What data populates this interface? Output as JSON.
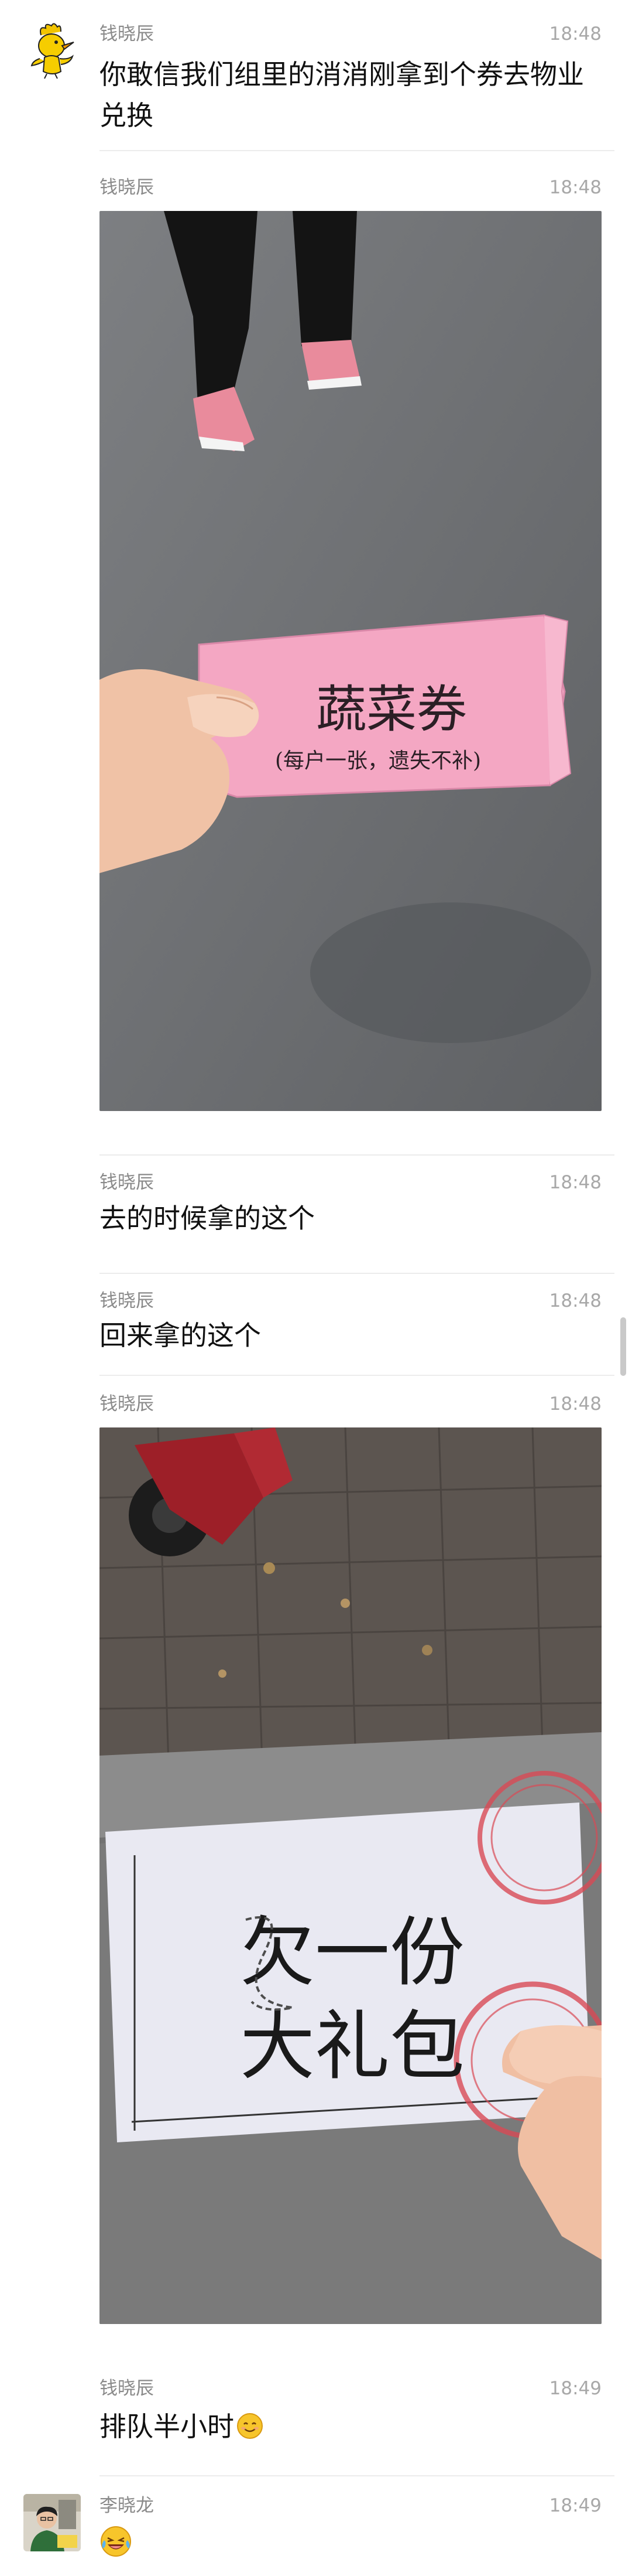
{
  "messages": [
    {
      "name": "钱晓辰",
      "time": "18:48",
      "text": "你敢信我们组里的消消刚拿到个券去物业兑换"
    },
    {
      "name": "钱晓辰",
      "time": "18:48"
    },
    {
      "name": "钱晓辰",
      "time": "18:48",
      "text": "去的时候拿的这个"
    },
    {
      "name": "钱晓辰",
      "time": "18:48",
      "text": "回来拿的这个"
    },
    {
      "name": "钱晓辰",
      "time": "18:48"
    },
    {
      "name": "钱晓辰",
      "time": "18:49",
      "text": "排队半小时"
    },
    {
      "name": "李晓龙",
      "time": "18:49"
    }
  ],
  "photo1": {
    "ticket_title": "蔬菜券",
    "ticket_note": "(每户一张，遗失不补)"
  },
  "photo2": {
    "ticket_line1": "欠一份",
    "ticket_line2": "大礼包"
  },
  "colors": {
    "name": "#8a8a8a",
    "time": "#a8a8a8",
    "text": "#111111",
    "divider": "#ececec"
  },
  "icons": [
    "woodstock-avatar-icon",
    "person-avatar-icon",
    "smile-emoji-icon",
    "laugh-cry-emoji-icon"
  ]
}
